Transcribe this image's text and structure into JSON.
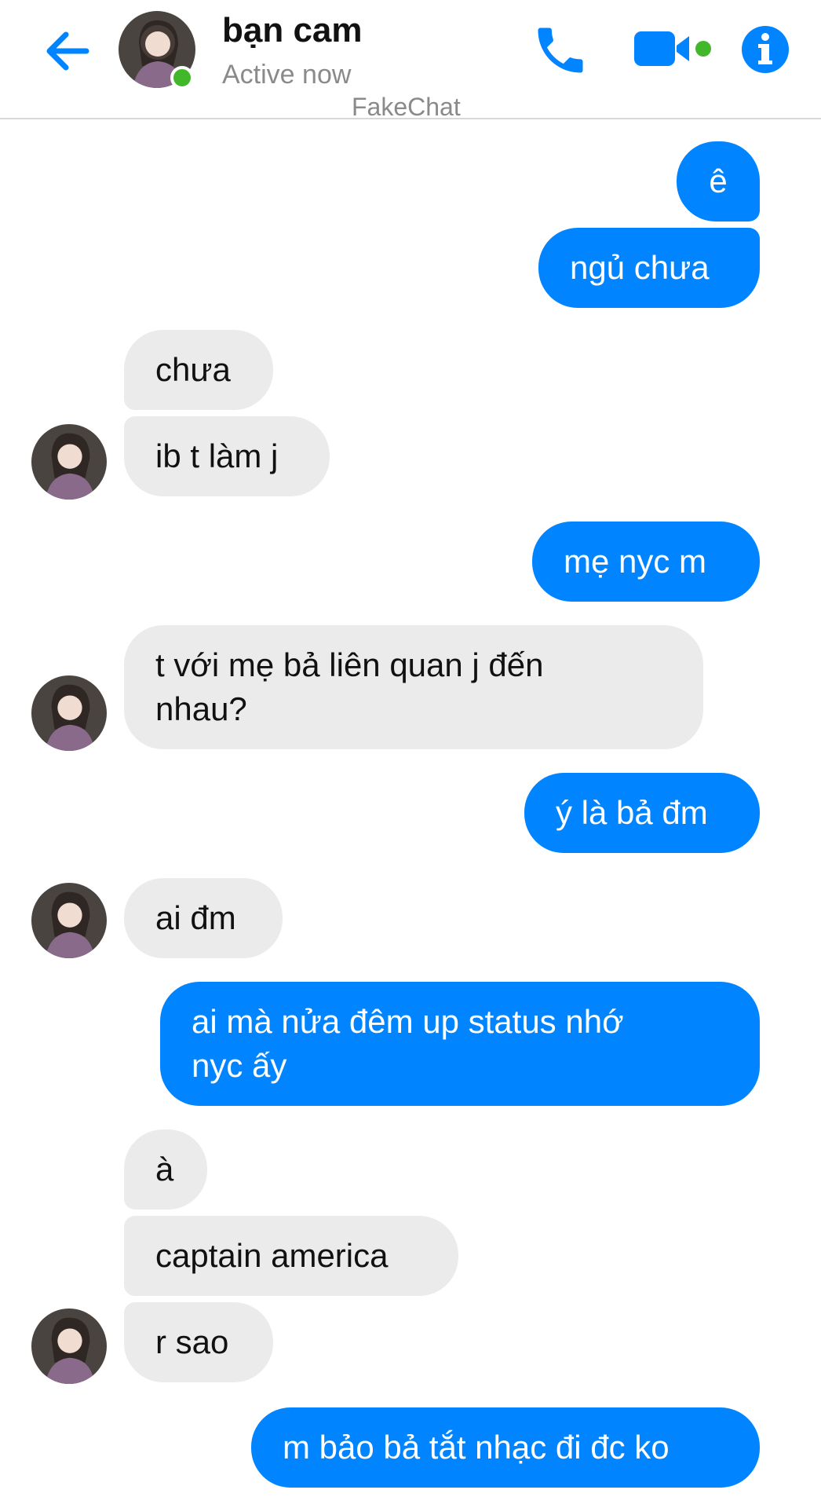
{
  "header": {
    "contact_name": "bạn cam",
    "status": "Active now",
    "watermark": "FakeChat"
  },
  "colors": {
    "accent": "#0084ff",
    "sent_bubble": "#0084ff",
    "received_bubble": "#ebebeb",
    "online": "#42b72a"
  },
  "messages": [
    {
      "from": "me",
      "text": "ê"
    },
    {
      "from": "me",
      "text": "ngủ chưa"
    },
    {
      "from": "them",
      "text": "chưa"
    },
    {
      "from": "them",
      "text": "ib t làm j"
    },
    {
      "from": "me",
      "text": "mẹ nyc m"
    },
    {
      "from": "them",
      "text": "t với mẹ bả liên quan j đến\nnhau?"
    },
    {
      "from": "me",
      "text": "ý là bả đm"
    },
    {
      "from": "them",
      "text": "ai đm"
    },
    {
      "from": "me",
      "text": "ai mà nửa đêm up status nhớ\nnyc ấy"
    },
    {
      "from": "them",
      "text": "à"
    },
    {
      "from": "them",
      "text": "captain america"
    },
    {
      "from": "them",
      "text": "r sao"
    },
    {
      "from": "me",
      "text": "m bảo bả tắt nhạc đi đc ko"
    }
  ],
  "icons": {
    "back": "arrow-left-icon",
    "call": "phone-icon",
    "video": "video-camera-icon",
    "info": "info-icon"
  }
}
